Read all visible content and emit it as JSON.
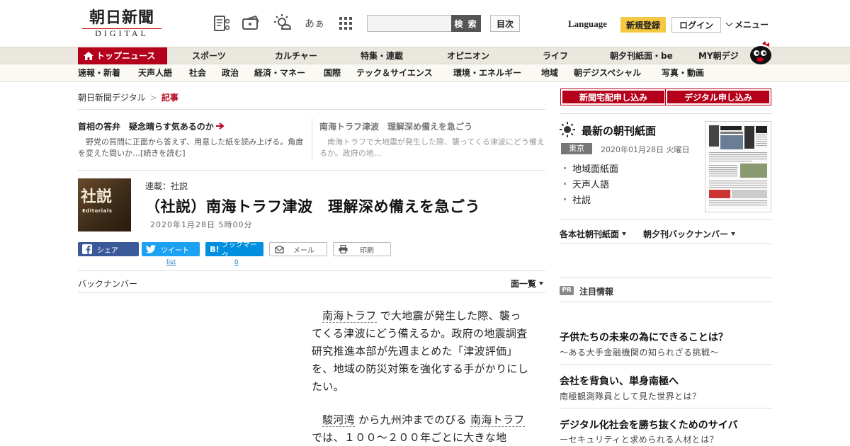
{
  "header": {
    "logo_main": "朝日新聞",
    "logo_sub": "DIGITAL",
    "search_placeholder": "",
    "search_label": "検 索",
    "toc_label": "目次",
    "language": "Language",
    "signup": "新規登録",
    "login": "ログイン",
    "menu": "メニュー",
    "font_size_icon_text": "あぁ"
  },
  "nav_main": {
    "items": [
      "トップニュース",
      "スポーツ",
      "カルチャー",
      "特集・連載",
      "オピニオン",
      "ライフ",
      "朝夕刊紙面・be",
      "MY朝デジ"
    ]
  },
  "nav_sub": {
    "items": [
      "速報・新着",
      "天声人語",
      "社会",
      "政治",
      "経済・マネー",
      "国際",
      "テック＆サイエンス",
      "環境・エネルギー",
      "地域",
      "朝デジスペシャル",
      "写真・動画"
    ]
  },
  "breadcrumb": {
    "home": "朝日新聞デジタル",
    "separator": ">",
    "current": "記事"
  },
  "featured": [
    {
      "title": "首相の答弁　疑念晴らす気あるのか",
      "desc": "野党の質問に正面から答えず、用意した紙を読み上げる。角度を変えた問いか…[続きを読む]"
    },
    {
      "title": "南海トラフ津波　理解深め備えを急ごう",
      "desc": "南海トラフで大地震が発生した際、襲ってくる津波にどう備えるか。政府の地…"
    }
  ],
  "article": {
    "thumb_big": "社説",
    "thumb_small": "Editorials",
    "series": "連載：社説",
    "title": "（社説）南海トラフ津波　理解深め備えを急ごう",
    "date": "2020年1月28日 5時00分",
    "p1_term": "南海トラフ",
    "p1_rest": "で大地震が発生した際、襲ってくる津波にどう備えるか。政府の地震調査研究推進本部が先週まとめた「津波評価」を、地域の防災対策を強化する手がかりにしたい。",
    "p2_term1": "駿河湾",
    "p2_mid": "から九州沖までのびる",
    "p2_term2": "南海トラフ",
    "p2_rest": "では、１００～２００年ごとに大きな地"
  },
  "share": {
    "facebook": "シェア",
    "twitter": "ツイート",
    "twitter_count": "list",
    "hatena": "ブックマーク",
    "hatena_icon": "B!",
    "hatena_count": "0",
    "mail": "メール",
    "print": "印刷"
  },
  "backnumber": {
    "label": "バックナンバー",
    "list": "面一覧"
  },
  "sidebar": {
    "subscribe_home": "新聞宅配申し込み",
    "subscribe_digital": "デジタル申し込み",
    "paper_title": "最新の朝刊紙面",
    "paper_region": "東京",
    "paper_date": "2020年01月28日 火曜日",
    "paper_links": [
      "地域面紙面",
      "天声人語",
      "社説"
    ],
    "dropdown1": "各本社朝刊紙面",
    "dropdown2": "朝夕刊バックナンバー",
    "pr_badge": "PR",
    "pr_title": "注目情報",
    "ads": [
      {
        "title": "子供たちの未来の為にできることは？",
        "sub": "～ある大手金融機関の知られざる挑戦～"
      },
      {
        "title": "会社を背負い、単身南極へ",
        "sub": "南極観測隊員として見た世界とは？"
      },
      {
        "title": "デジタル化社会を勝ち抜くためのサイバ",
        "sub": "ーセキュリティと求められる人材とは？"
      }
    ]
  },
  "colors": {
    "brand_red": "#b5001b",
    "signup_yellow": "#f5c842",
    "facebook": "#3b5998",
    "twitter": "#1da1f2",
    "hatena": "#008fde"
  }
}
